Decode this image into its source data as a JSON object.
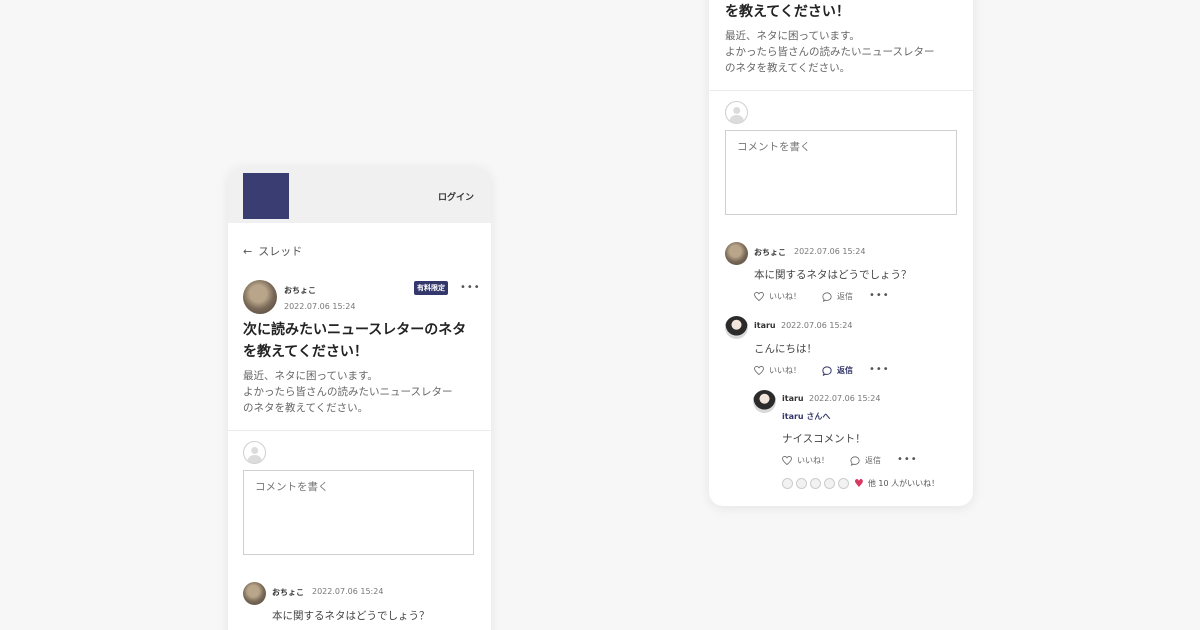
{
  "header": {
    "login_label": "ログイン"
  },
  "nav": {
    "back_arrow": "←",
    "back_label": "スレッド"
  },
  "post": {
    "author": "おちょこ",
    "date": "2022.07.06 15:24",
    "badge": "有料限定",
    "more": "•••",
    "title": "次に読みたいニュースレターのネタを教えてください！",
    "title_partial": "を教えてください！",
    "body_lines": [
      "最近、ネタに困っています。",
      "よかったら皆さんの読みたいニュースレター",
      "のネタを教えてください。"
    ]
  },
  "comment_input": {
    "placeholder": "コメントを書く"
  },
  "comments": [
    {
      "author": "おちょこ",
      "date": "2022.07.06 15:24",
      "text": "本に関するネタはどうでしょう？",
      "like_label": "いいね！",
      "reply_label": "返信",
      "more": "•••"
    },
    {
      "author": "itaru",
      "date": "2022.07.06 15:24",
      "text": "こんにちは！",
      "like_label": "いいね！",
      "reply_label": "返信",
      "more": "•••"
    }
  ],
  "reply": {
    "author": "itaru",
    "date": "2022.07.06 15:24",
    "reply_to": "itaru さんへ",
    "text": "ナイスコメント！",
    "like_label": "いいね！",
    "reply_label": "返信",
    "more": "•••",
    "likers_text": "他 10 人がいいね！",
    "heart": "♥"
  },
  "colors": {
    "accent": "#34376a",
    "logo": "#3a3d72",
    "heart": "#d63a5f",
    "background": "#f7f7f7"
  }
}
